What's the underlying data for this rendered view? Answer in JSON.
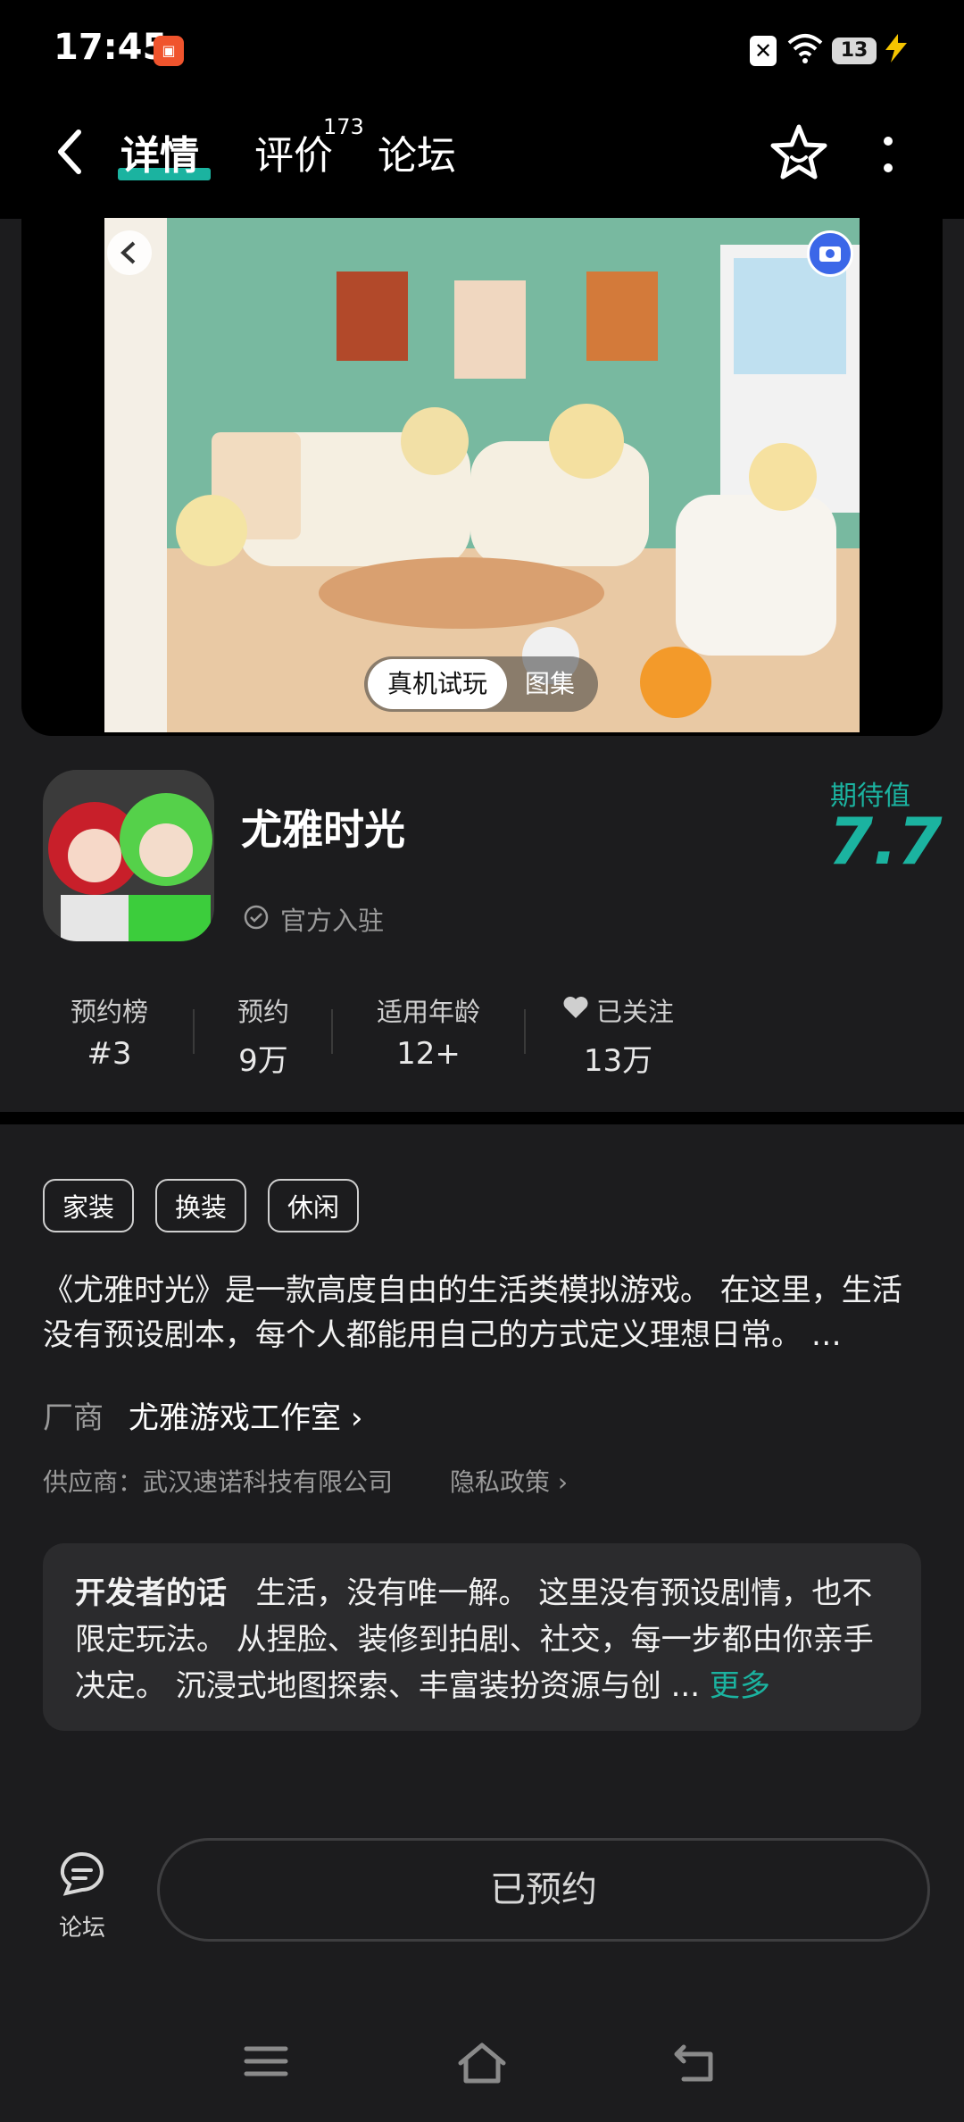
{
  "status_bar": {
    "time": "17:45",
    "notification_badge_text": "",
    "battery_level": "13"
  },
  "header": {
    "tabs": [
      {
        "label": "详情",
        "active": true
      },
      {
        "label": "评价",
        "badge": "173"
      },
      {
        "label": "论坛"
      }
    ]
  },
  "media": {
    "chips": [
      "真机试玩",
      "图集"
    ]
  },
  "app": {
    "name": "尤雅时光",
    "official_label": "官方入驻",
    "score_label": "期待值",
    "score_value": "7.7"
  },
  "stats": [
    {
      "label": "预约榜",
      "value": "#3"
    },
    {
      "label": "预约",
      "value": "9万"
    },
    {
      "label": "适用年龄",
      "value": "12+"
    },
    {
      "label": "已关注",
      "value": "13万"
    }
  ],
  "tags": [
    "家装",
    "换装",
    "休闲"
  ],
  "description": "《尤雅时光》是一款高度自由的生活类模拟游戏。 在这里，生活没有预设剧本，每个人都能用自己的方式定义理想日常。 …",
  "vendor": {
    "label": "厂商",
    "name": "尤雅游戏工作室",
    "supplier": "供应商：武汉速诺科技有限公司",
    "privacy": "隐私政策"
  },
  "developer_note": {
    "title": "开发者的话",
    "text": "生活，没有唯一解。 这里没有预设剧情，也不限定玩法。 从捏脸、装修到拍剧、社交，每一步都由你亲手决定。 沉浸式地图探索、丰富装扮资源与创 ...",
    "more": "更多"
  },
  "bottom": {
    "forum_label": "论坛",
    "reserve_label": "已预约"
  },
  "colors": {
    "accent": "#1bb3a0",
    "background": "#1c1c1e"
  }
}
